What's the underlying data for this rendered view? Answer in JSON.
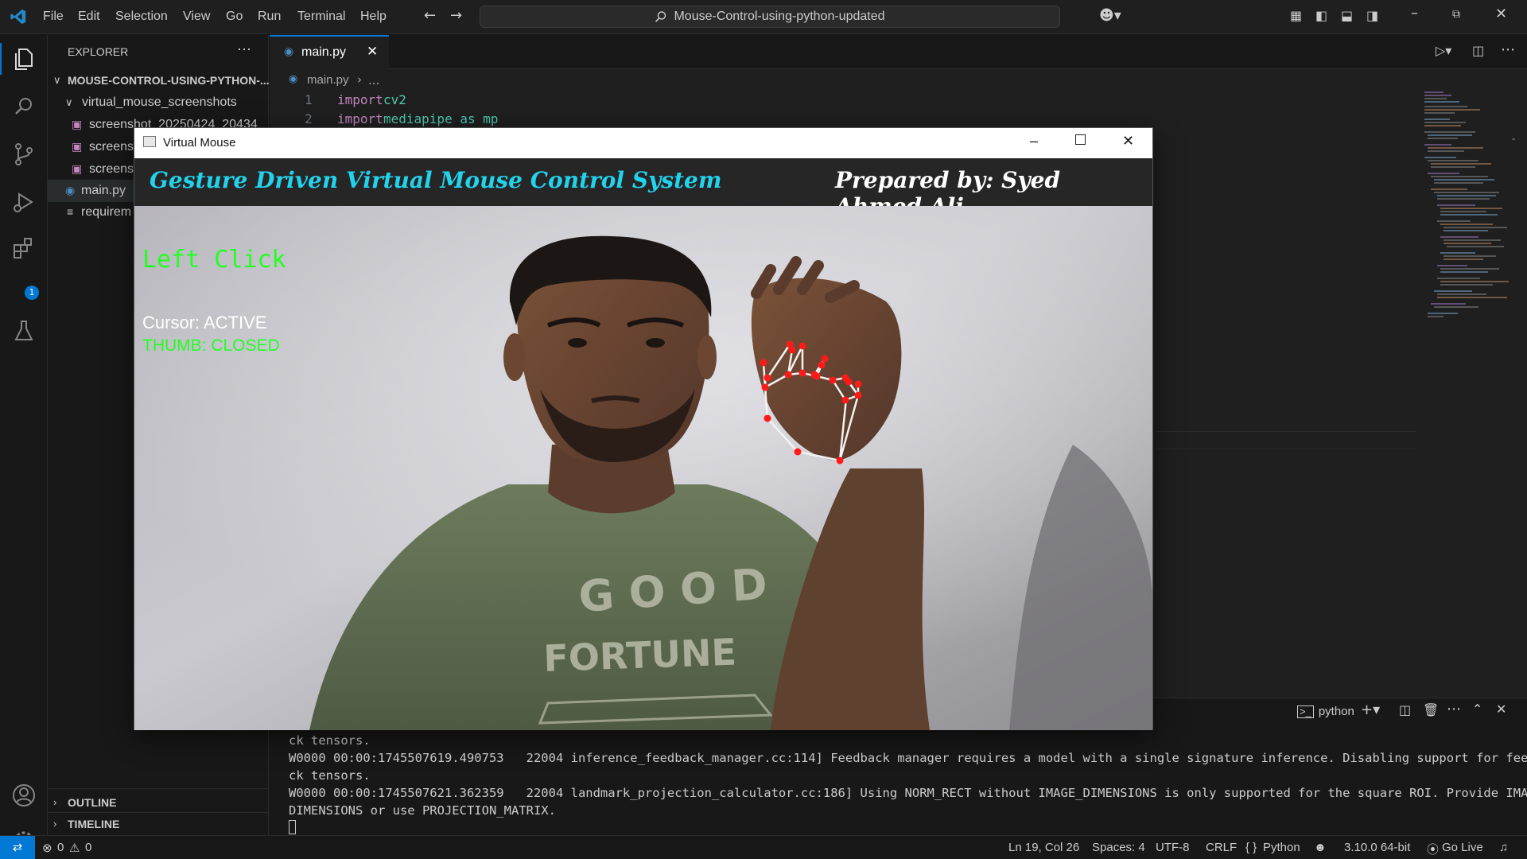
{
  "menu": [
    "File",
    "Edit",
    "Selection",
    "View",
    "Go",
    "Run",
    "Terminal",
    "Help"
  ],
  "command_center": "Mouse-Control-using-python-updated",
  "sidebar": {
    "header": "EXPLORER",
    "project": "MOUSE-CONTROL-USING-PYTHON-...",
    "folder": "virtual_mouse_screenshots",
    "items": [
      "screenshot_20250424_20434",
      "screensl",
      "screensl",
      "main.py",
      "requirem"
    ],
    "outline": "OUTLINE",
    "timeline": "TIMELINE",
    "extensions_badge": "1"
  },
  "editor": {
    "tab": "main.py",
    "breadcrumb_file": "main.py",
    "breadcrumb_rest": "...",
    "lines": [
      {
        "n": "1",
        "kw": "import",
        "rest": " cv2"
      },
      {
        "n": "2",
        "kw": "import",
        "rest": " mediapipe as mp"
      }
    ]
  },
  "overlay": {
    "title": "Virtual Mouse",
    "heading": "Gesture Driven Virtual Mouse Control System",
    "credit": "Prepared by: Syed Ahmed Ali",
    "action": "Left Click",
    "cursor": "Cursor: ACTIVE",
    "thumb": "THUMB: CLOSED",
    "shirt_top": "G O O D",
    "shirt_bottom": "FORTUNE"
  },
  "terminal": {
    "profile": "python",
    "lines": [
      "ck tensors.",
      "W0000 00:00:1745507619.490753   22004 inference_feedback_manager.cc:114] Feedback manager requires a model with a single signature inference. Disabling support for feedba",
      "ck tensors.",
      "W0000 00:00:1745507621.362359   22004 landmark_projection_calculator.cc:186] Using NORM_RECT without IMAGE_DIMENSIONS is only supported for the square ROI. Provide IMAGE_",
      "DIMENSIONS or use PROJECTION_MATRIX."
    ]
  },
  "status": {
    "errors": "0",
    "warnings": "0",
    "position": "Ln 19, Col 26",
    "spaces": "Spaces: 4",
    "encoding": "UTF-8",
    "eol": "CRLF",
    "language": "Python",
    "interpreter": "3.10.0 64-bit",
    "golive": "Go Live"
  },
  "colors": {
    "accent": "#0078d4",
    "heading_cyan": "#22d3ee",
    "overlay_green": "#22ff22",
    "landmark_red": "#ff1a1a"
  }
}
